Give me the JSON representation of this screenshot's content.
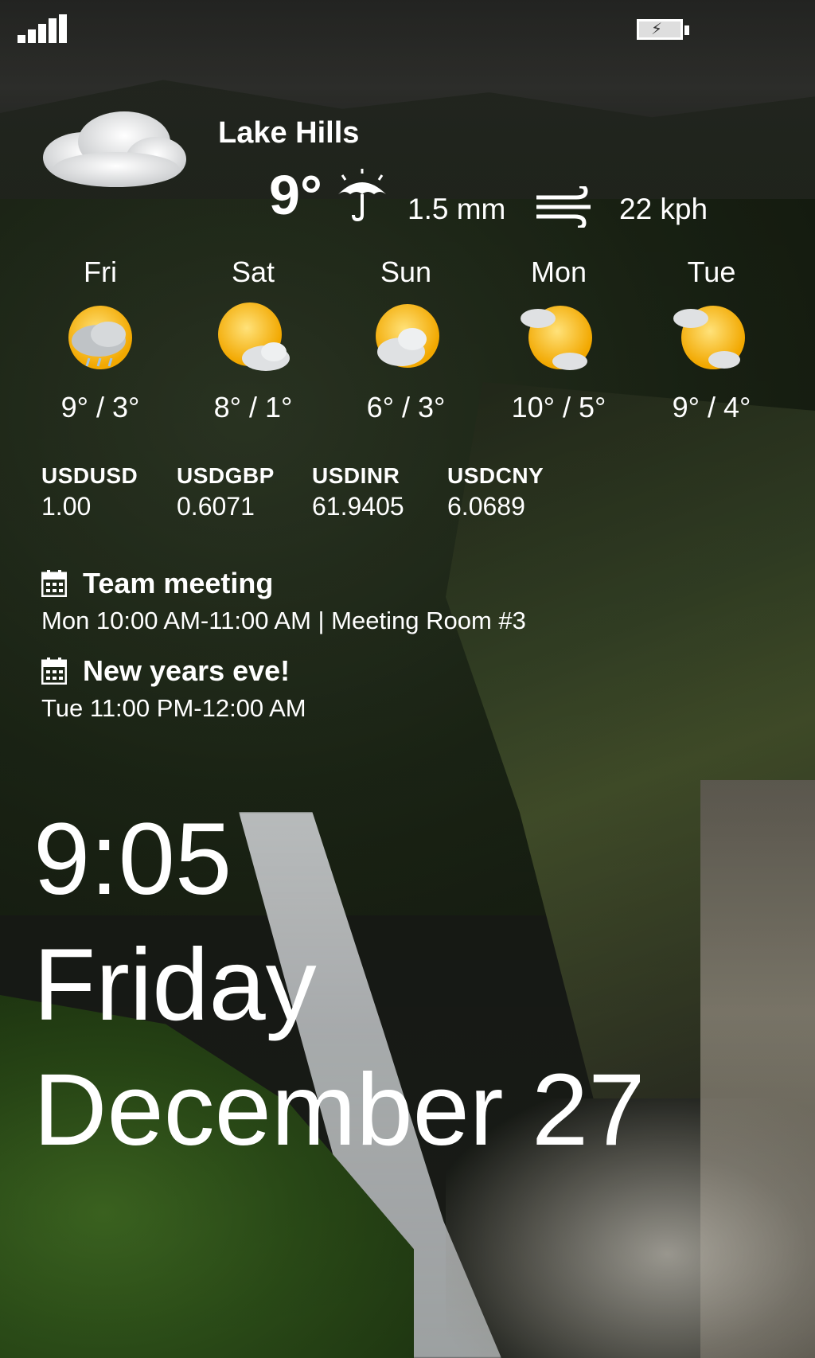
{
  "status_bar": {
    "signal_icon": "signal-bars-icon",
    "battery_icon": "battery-charging-icon"
  },
  "weather": {
    "location": "Lake Hills",
    "current_temp": "9°",
    "condition_icon": "cloud-icon",
    "precip_icon": "umbrella-rain-icon",
    "precipitation": "1.5 mm",
    "wind_icon": "wind-icon",
    "wind_speed": "22 kph"
  },
  "forecast": [
    {
      "day": "Fri",
      "temps": "9° / 3°",
      "icon": "sun-cloud-rain-icon"
    },
    {
      "day": "Sat",
      "temps": "8° / 1°",
      "icon": "sun-cloud-icon"
    },
    {
      "day": "Sun",
      "temps": "6° / 3°",
      "icon": "sun-cloud-icon"
    },
    {
      "day": "Mon",
      "temps": "10° / 5°",
      "icon": "sun-clouds-icon"
    },
    {
      "day": "Tue",
      "temps": "9° / 4°",
      "icon": "sun-clouds-icon"
    }
  ],
  "currency": [
    {
      "code": "USDUSD",
      "rate": "1.00"
    },
    {
      "code": "USDGBP",
      "rate": "0.6071"
    },
    {
      "code": "USDINR",
      "rate": "61.9405"
    },
    {
      "code": "USDCNY",
      "rate": "6.0689"
    }
  ],
  "events": [
    {
      "title": "Team meeting",
      "detail": "Mon 10:00 AM-11:00 AM | Meeting Room #3",
      "icon": "calendar-icon"
    },
    {
      "title": "New years eve!",
      "detail": "Tue 11:00 PM-12:00 AM",
      "icon": "calendar-icon"
    }
  ],
  "clock": {
    "time": "9:05",
    "day": "Friday",
    "date": "December 27"
  }
}
